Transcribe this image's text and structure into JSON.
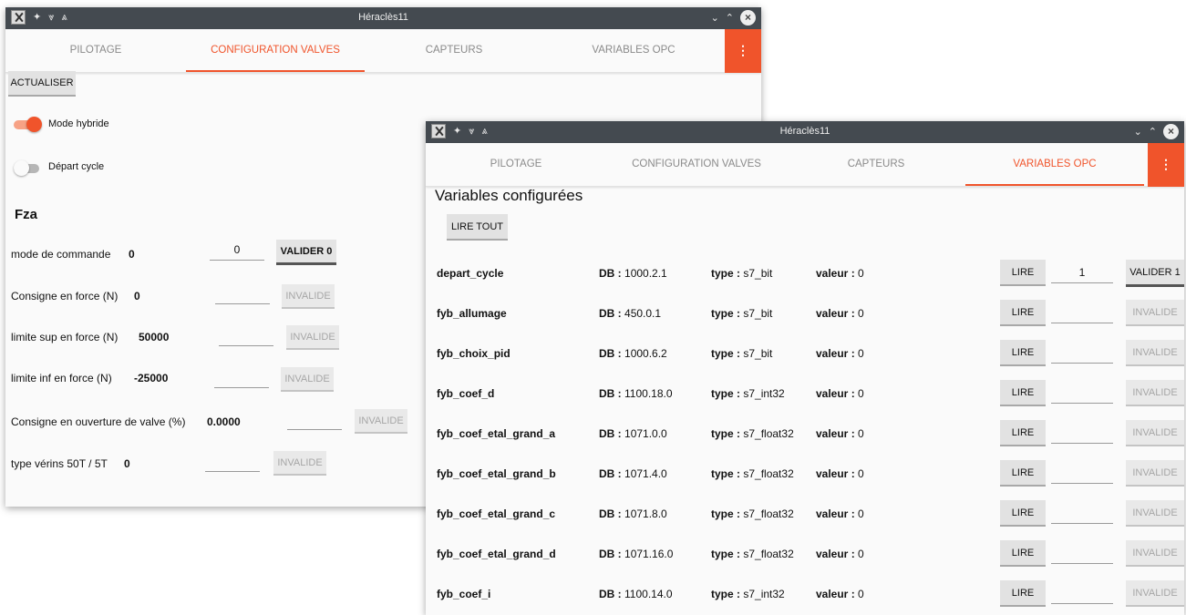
{
  "window1": {
    "title": "Héraclès11",
    "tabs": [
      "PILOTAGE",
      "CONFIGURATION VALVES",
      "CAPTEURS",
      "VARIABLES OPC"
    ],
    "menu_icon": "⋮",
    "refresh_label": "ACTUALISER",
    "hybrid_toggle": {
      "label": "Mode hybride",
      "on": true
    },
    "cycle_toggle": {
      "label": "Départ cycle",
      "on": false
    },
    "section_title": "Fza",
    "rows": [
      {
        "label": "mode de commande",
        "value": "0",
        "input": "0",
        "button": "VALIDER 0",
        "enabled": true
      },
      {
        "label": "Consigne en force (N)",
        "value": "0",
        "input": "",
        "button": "INVALIDE",
        "enabled": false
      },
      {
        "label": "limite sup en force (N)",
        "value": "50000",
        "input": "",
        "button": "INVALIDE",
        "enabled": false
      },
      {
        "label": "limite inf en force (N)",
        "value": "-25000",
        "input": "",
        "button": "INVALIDE",
        "enabled": false
      },
      {
        "label": "Consigne en ouverture de valve (%)",
        "value": "0.0000",
        "input": "",
        "button": "INVALIDE",
        "enabled": false
      },
      {
        "label": "type vérins 50T / 5T",
        "value": "0",
        "input": "",
        "button": "INVALIDE",
        "enabled": false
      }
    ]
  },
  "window2": {
    "title": "Héraclès11",
    "tabs": [
      "PILOTAGE",
      "CONFIGURATION VALVES",
      "CAPTEURS",
      "VARIABLES OPC"
    ],
    "menu_icon": "⋮",
    "heading": "Variables configurées",
    "read_all_label": "LIRE TOUT",
    "db_key": "DB :",
    "type_key": "type :",
    "value_key": "valeur :",
    "read_label": "LIRE",
    "variables": [
      {
        "name": "depart_cycle",
        "db": "1000.2.1",
        "type": "s7_bit",
        "valeur": "0",
        "input": "1",
        "button": "VALIDER 1",
        "enabled": true
      },
      {
        "name": "fyb_allumage",
        "db": "450.0.1",
        "type": "s7_bit",
        "valeur": "0",
        "input": "",
        "button": "INVALIDE",
        "enabled": false
      },
      {
        "name": "fyb_choix_pid",
        "db": "1000.6.2",
        "type": "s7_bit",
        "valeur": "0",
        "input": "",
        "button": "INVALIDE",
        "enabled": false
      },
      {
        "name": "fyb_coef_d",
        "db": "1100.18.0",
        "type": "s7_int32",
        "valeur": "0",
        "input": "",
        "button": "INVALIDE",
        "enabled": false
      },
      {
        "name": "fyb_coef_etal_grand_a",
        "db": "1071.0.0",
        "type": "s7_float32",
        "valeur": "0",
        "input": "",
        "button": "INVALIDE",
        "enabled": false
      },
      {
        "name": "fyb_coef_etal_grand_b",
        "db": "1071.4.0",
        "type": "s7_float32",
        "valeur": "0",
        "input": "",
        "button": "INVALIDE",
        "enabled": false
      },
      {
        "name": "fyb_coef_etal_grand_c",
        "db": "1071.8.0",
        "type": "s7_float32",
        "valeur": "0",
        "input": "",
        "button": "INVALIDE",
        "enabled": false
      },
      {
        "name": "fyb_coef_etal_grand_d",
        "db": "1071.16.0",
        "type": "s7_float32",
        "valeur": "0",
        "input": "",
        "button": "INVALIDE",
        "enabled": false
      },
      {
        "name": "fyb_coef_i",
        "db": "1100.14.0",
        "type": "s7_int32",
        "valeur": "0",
        "input": "",
        "button": "INVALIDE",
        "enabled": false
      }
    ]
  },
  "colors": {
    "accent": "#f0542b",
    "titlebar": "#444a50"
  }
}
